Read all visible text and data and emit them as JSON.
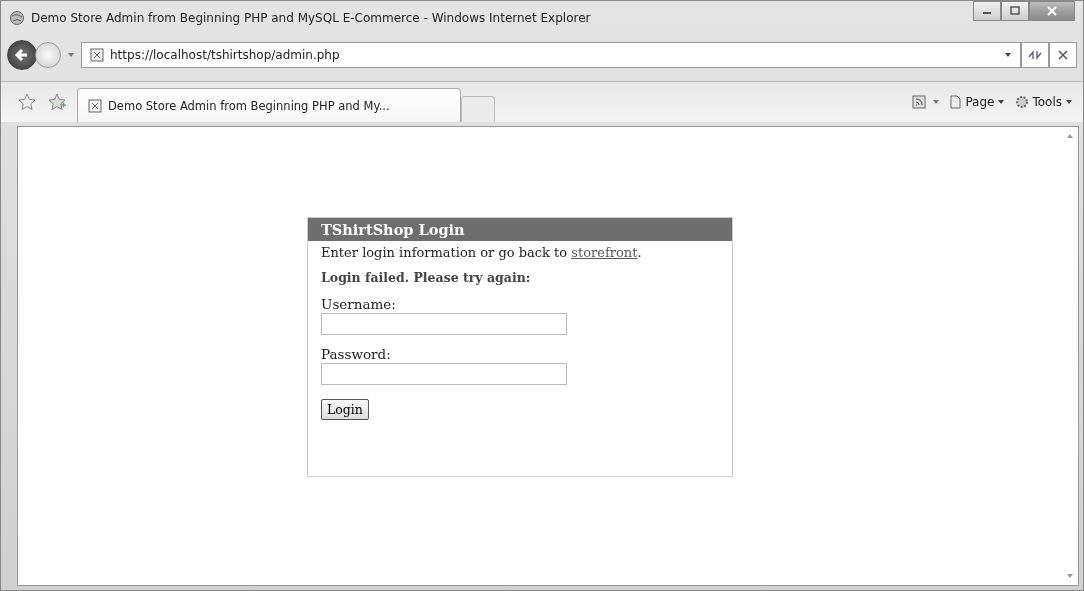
{
  "window": {
    "title": "Demo Store Admin from Beginning PHP and MySQL E-Commerce - Windows Internet Explorer"
  },
  "address_bar": {
    "url": "https://localhost/tshirtshop/admin.php"
  },
  "tabs": [
    {
      "label": "Demo Store Admin from Beginning PHP and My...",
      "selected": true
    }
  ],
  "command_bar": {
    "page_menu": "Page",
    "tools_menu": "Tools"
  },
  "login": {
    "title": "TShirtShop Login",
    "intro": "Enter login information or go back to ",
    "link": "storefront",
    "intro_end": ".",
    "error": "Login failed. Please try again:",
    "fields": [
      {
        "label": "Username:"
      },
      {
        "label": "Password:"
      }
    ],
    "button": "Login"
  }
}
